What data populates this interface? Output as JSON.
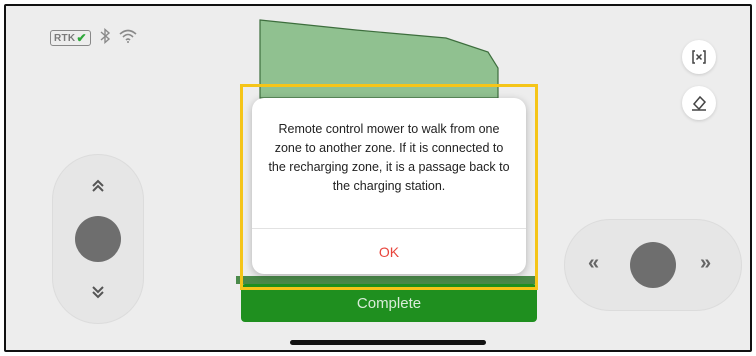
{
  "status_bar": {
    "rtk_label": "RTK",
    "rtk_check": "✔",
    "bluetooth_icon": "bluetooth-icon",
    "wifi_icon": "wifi-icon"
  },
  "toolbar": {
    "exit_icon": "exit-icon",
    "eraser_icon": "eraser-icon"
  },
  "joystick_vertical": {
    "up": "≈",
    "down": "≈"
  },
  "joystick_horizontal": {
    "left": "«",
    "right": "»"
  },
  "dialog": {
    "message": "Remote control mower to walk from one zone to another zone. If it is connected to the recharging zone, it is a passage back to the charging station.",
    "ok_label": "OK"
  },
  "complete_label": "Complete",
  "colors": {
    "map_fill": "#7fb87f",
    "complete": "#1f8f1f",
    "highlight": "#f5c518",
    "ok": "#e8453c"
  }
}
